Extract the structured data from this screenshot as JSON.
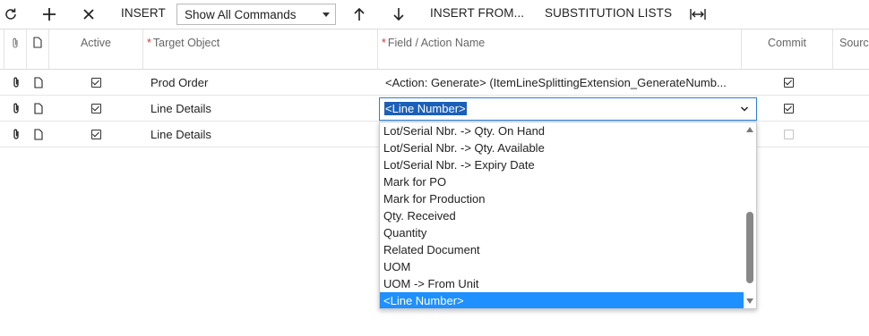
{
  "toolbar": {
    "insert_label": "INSERT",
    "commands_select_value": "Show All Commands",
    "insert_from_label": "INSERT FROM...",
    "substitution_lists_label": "SUBSTITUTION LISTS"
  },
  "grid": {
    "headers": {
      "active": "Active",
      "target_object": "Target Object",
      "field_action": "Field / Action Name",
      "commit": "Commit",
      "source": "Sourc"
    },
    "rows": [
      {
        "target": "Prod Order",
        "field": "<Action: Generate> (ItemLineSplittingExtension_GenerateNumb...",
        "active": true,
        "commit": true
      },
      {
        "target": "Line Details",
        "field": "<Line Number>",
        "active": true,
        "commit": true
      },
      {
        "target": "Line Details",
        "field": "",
        "active": true,
        "commit": false
      }
    ]
  },
  "dropdown": {
    "options": [
      "Lot/Serial Nbr. -> Qty. On Hand",
      "Lot/Serial Nbr. -> Qty. Available",
      "Lot/Serial Nbr. -> Expiry Date",
      "Mark for PO",
      "Mark for Production",
      "Qty. Received",
      "Quantity",
      "Related Document",
      "UOM",
      "UOM -> From Unit",
      "<Line Number>"
    ],
    "selected": "<Line Number>"
  },
  "colors": {
    "selection_blue": "#1e90ff",
    "editor_highlight": "#1b5fb8",
    "required_red": "#dd3333"
  }
}
